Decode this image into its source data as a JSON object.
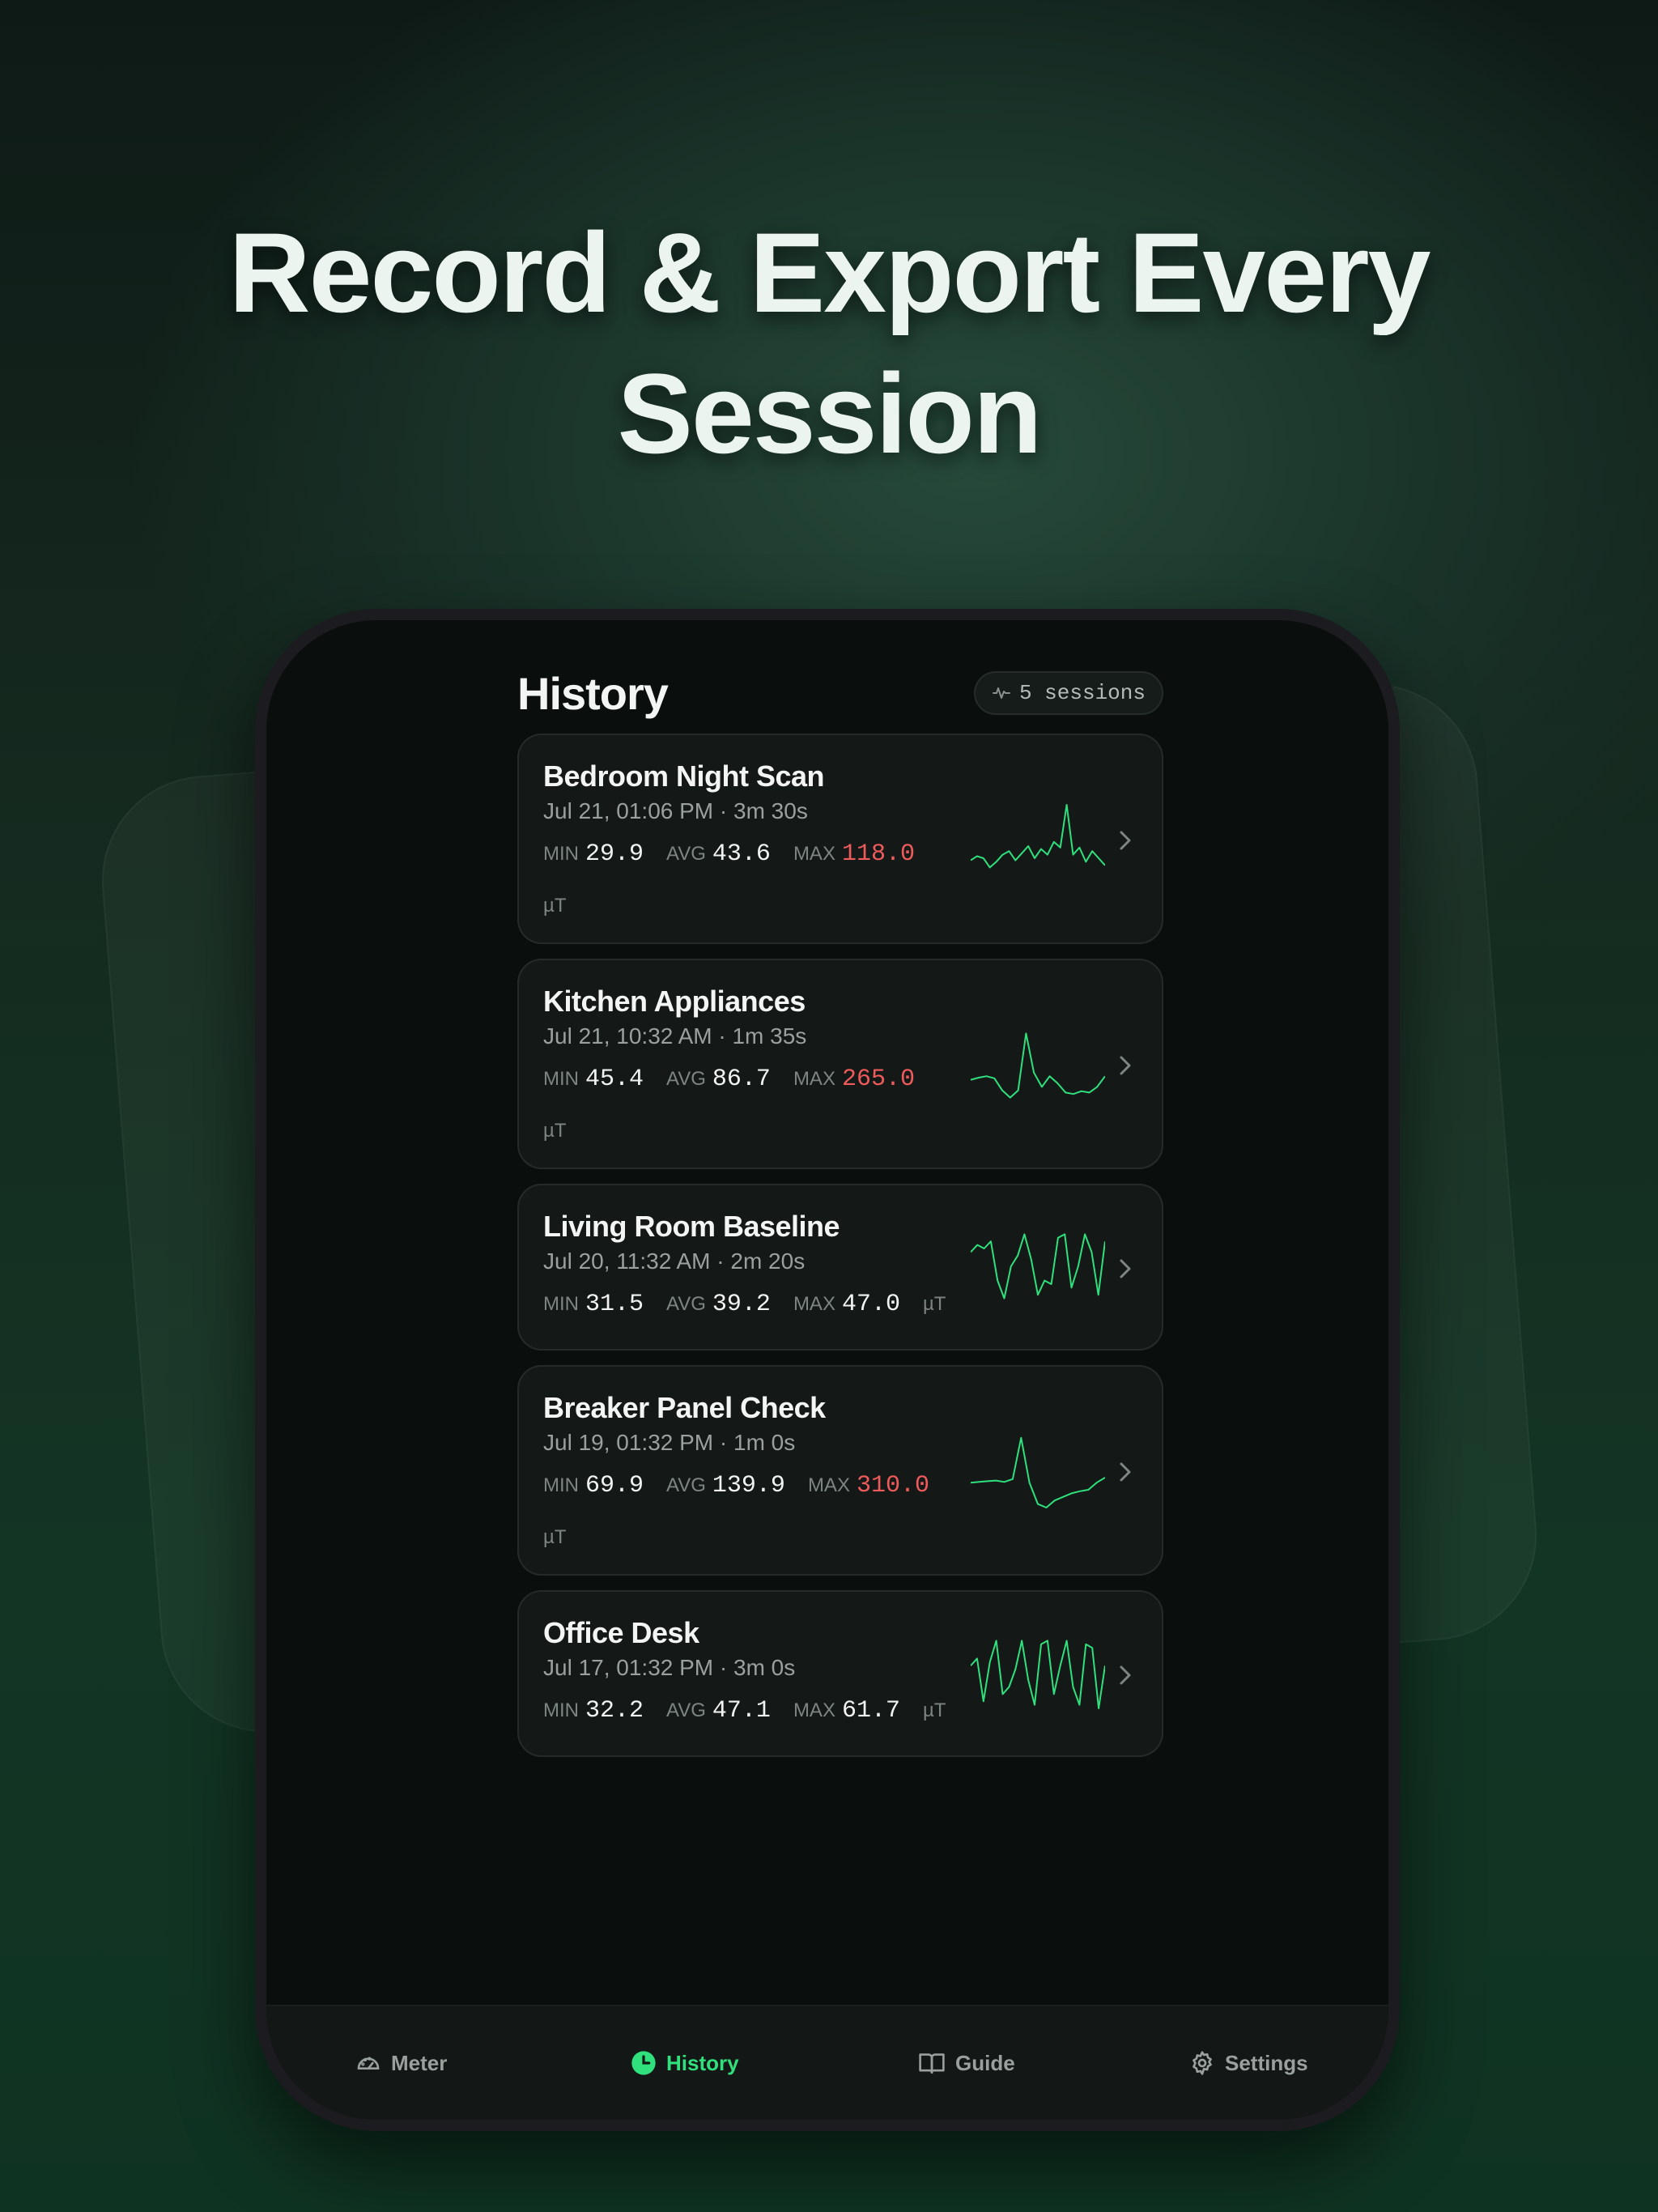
{
  "headline": {
    "line1": "Record & Export Every",
    "line2": "Session"
  },
  "screen": {
    "title": "History",
    "sessions_badge": {
      "icon": "waveform-icon",
      "label": "5 sessions"
    }
  },
  "labels": {
    "min": "MIN",
    "avg": "AVG",
    "max": "MAX",
    "unit": "µT"
  },
  "sessions": [
    {
      "name": "Bedroom Night Scan",
      "meta": "Jul 21, 01:06 PM · 3m 30s",
      "min": "29.9",
      "avg": "43.6",
      "max": "118.0",
      "max_alert": true,
      "trend": [
        0.22,
        0.28,
        0.25,
        0.12,
        0.2,
        0.3,
        0.35,
        0.22,
        0.32,
        0.42,
        0.25,
        0.38,
        0.3,
        0.48,
        0.4,
        1.0,
        0.3,
        0.4,
        0.2,
        0.35,
        0.25,
        0.15
      ]
    },
    {
      "name": "Kitchen Appliances",
      "meta": "Jul 21, 10:32 AM · 1m 35s",
      "min": "45.4",
      "avg": "86.7",
      "max": "265.0",
      "max_alert": true,
      "trend": [
        0.3,
        0.33,
        0.35,
        0.32,
        0.15,
        0.05,
        0.15,
        0.95,
        0.4,
        0.2,
        0.35,
        0.25,
        0.12,
        0.1,
        0.14,
        0.12,
        0.2,
        0.35
      ]
    },
    {
      "name": "Living Room Baseline",
      "meta": "Jul 20, 11:32 AM · 2m 20s",
      "min": "31.5",
      "avg": "39.2",
      "max": "47.0",
      "max_alert": false,
      "trend": [
        0.7,
        0.8,
        0.75,
        0.85,
        0.3,
        0.05,
        0.5,
        0.65,
        0.95,
        0.6,
        0.1,
        0.3,
        0.25,
        0.9,
        0.95,
        0.2,
        0.5,
        0.95,
        0.7,
        0.1,
        0.85
      ]
    },
    {
      "name": "Breaker Panel Check",
      "meta": "Jul 19, 01:32 PM · 1m 0s",
      "min": "69.9",
      "avg": "139.9",
      "max": "310.0",
      "max_alert": true,
      "trend": [
        0.35,
        0.36,
        0.37,
        0.38,
        0.36,
        0.4,
        0.98,
        0.35,
        0.05,
        0.0,
        0.1,
        0.15,
        0.2,
        0.23,
        0.25,
        0.35,
        0.42
      ]
    },
    {
      "name": "Office Desk",
      "meta": "Jul 17, 01:32 PM · 3m 0s",
      "min": "32.2",
      "avg": "47.1",
      "max": "61.7",
      "max_alert": false,
      "trend": [
        0.6,
        0.7,
        0.1,
        0.65,
        0.95,
        0.2,
        0.3,
        0.55,
        0.95,
        0.4,
        0.05,
        0.9,
        0.95,
        0.2,
        0.6,
        0.95,
        0.3,
        0.05,
        0.9,
        0.85,
        0.0,
        0.6
      ]
    }
  ],
  "tabs": [
    {
      "label": "Meter",
      "icon": "speedometer-icon",
      "active": false
    },
    {
      "label": "History",
      "icon": "clock-icon",
      "active": true
    },
    {
      "label": "Guide",
      "icon": "book-icon",
      "active": false
    },
    {
      "label": "Settings",
      "icon": "gear-icon",
      "active": false
    }
  ],
  "colors": {
    "accent": "#2fe07c",
    "alert": "#ef5b5b",
    "background": "#0a0e0d"
  }
}
